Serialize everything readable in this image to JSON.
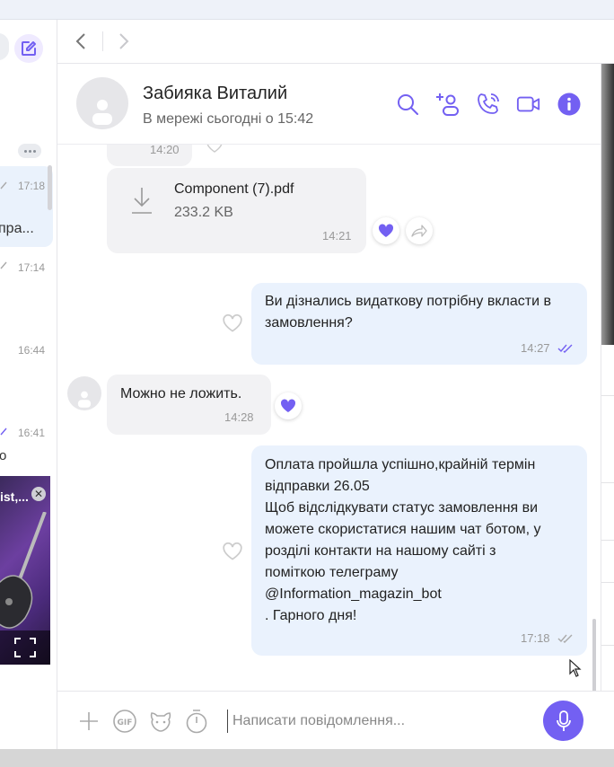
{
  "contact": {
    "name": "Забияка Виталий",
    "status": "В мережі сьогодні о 15:42"
  },
  "sidebar": {
    "items": [
      {
        "time": "17:18",
        "snippet": "пра..."
      },
      {
        "time": "17:14",
        "snippet": ""
      },
      {
        "time": "16:44",
        "snippet": ""
      },
      {
        "time": "16:41",
        "snippet": "о"
      }
    ],
    "video_title": "ist,..."
  },
  "messages": [
    {
      "time": "14:20"
    },
    {
      "file_name": "Component (7).pdf",
      "file_size": "233.2 KB",
      "time": "14:21"
    },
    {
      "lines": [
        "Ви дізнались видаткову потрібну вкласти в",
        "замовлення?"
      ],
      "time": "14:27"
    },
    {
      "text": "Можно не ложить.",
      "time": "14:28"
    },
    {
      "lines": [
        "Оплата пройшла успішно,крайній термін",
        "відправки 26.05",
        "Щоб відслідкувати статус замовлення ви",
        "можете скористатися нашим чат ботом, у",
        "розділі контакти на нашому сайті з",
        "поміткою телеграму",
        "@Information_magazin_bot",
        ". Гарного дня!"
      ],
      "time": "17:18"
    }
  ],
  "composer": {
    "placeholder": "Написати повідомлення..."
  },
  "colors": {
    "accent": "#7360f2",
    "outgoing_bubble": "#eaf2fd",
    "incoming_bubble": "#f2f2f4"
  },
  "icons": [
    "back-arrow-icon",
    "forward-arrow-icon",
    "compose-icon",
    "search-icon",
    "add-participant-icon",
    "voice-call-icon",
    "video-call-icon",
    "info-icon",
    "download-icon",
    "heart-icon",
    "forward-share-icon",
    "double-check-icon",
    "plus-icon",
    "gif-icon",
    "sticker-icon",
    "timer-icon",
    "microphone-icon",
    "fullscreen-icon",
    "close-icon"
  ]
}
